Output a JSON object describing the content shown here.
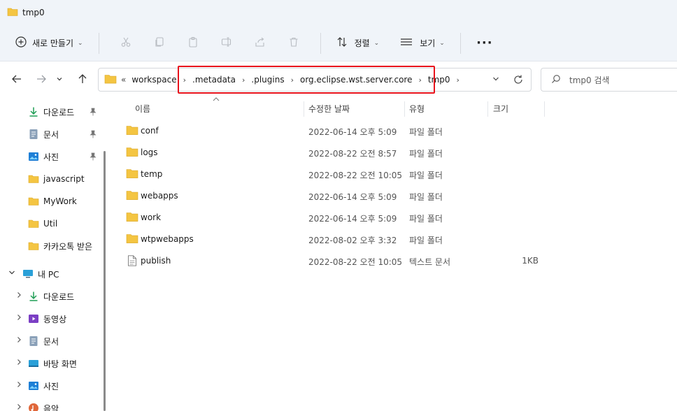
{
  "window": {
    "title": "tmp0"
  },
  "toolbar": {
    "new_label": "새로 만들기",
    "sort_label": "정렬",
    "view_label": "보기",
    "more_label": "···"
  },
  "address": {
    "overflow": "«",
    "crumbs": [
      "workspace",
      ".metadata",
      ".plugins",
      "org.eclipse.wst.server.core",
      "tmp0"
    ],
    "separator": "›"
  },
  "search": {
    "placeholder": "tmp0 검색"
  },
  "sidebar": {
    "quick": [
      {
        "label": "다운로드",
        "icon": "download-icon"
      },
      {
        "label": "문서",
        "icon": "document-icon"
      },
      {
        "label": "사진",
        "icon": "picture-icon"
      },
      {
        "label": "javascript",
        "icon": "folder-icon"
      },
      {
        "label": "MyWork",
        "icon": "folder-icon"
      },
      {
        "label": "Util",
        "icon": "folder-icon"
      },
      {
        "label": "카카오톡 받은",
        "icon": "folder-icon"
      }
    ],
    "pc": {
      "label": "내 PC",
      "icon": "pc-icon"
    },
    "pc_items": [
      {
        "label": "다운로드",
        "icon": "download-icon"
      },
      {
        "label": "동영상",
        "icon": "video-icon"
      },
      {
        "label": "문서",
        "icon": "document-icon"
      },
      {
        "label": "바탕 화면",
        "icon": "desktop-icon"
      },
      {
        "label": "사진",
        "icon": "picture-icon"
      },
      {
        "label": "음악",
        "icon": "music-icon"
      }
    ]
  },
  "columns": {
    "name": "이름",
    "date": "수정한 날짜",
    "type": "유형",
    "size": "크기"
  },
  "files": [
    {
      "name": "conf",
      "date": "2022-06-14 오후 5:09",
      "type": "파일 폴더",
      "size": "",
      "icon": "folder-icon"
    },
    {
      "name": "logs",
      "date": "2022-08-22 오전 8:57",
      "type": "파일 폴더",
      "size": "",
      "icon": "folder-icon"
    },
    {
      "name": "temp",
      "date": "2022-08-22 오전 10:05",
      "type": "파일 폴더",
      "size": "",
      "icon": "folder-icon"
    },
    {
      "name": "webapps",
      "date": "2022-06-14 오후 5:09",
      "type": "파일 폴더",
      "size": "",
      "icon": "folder-icon"
    },
    {
      "name": "work",
      "date": "2022-06-14 오후 5:09",
      "type": "파일 폴더",
      "size": "",
      "icon": "folder-icon"
    },
    {
      "name": "wtpwebapps",
      "date": "2022-08-02 오후 3:32",
      "type": "파일 폴더",
      "size": "",
      "icon": "folder-icon"
    },
    {
      "name": "publish",
      "date": "2022-08-22 오전 10:05",
      "type": "텍스트 문서",
      "size": "1KB",
      "icon": "text-file-icon"
    }
  ],
  "colors": {
    "folder": "#f4c542",
    "highlight": "#e8131c",
    "accent": "#0f6cbd",
    "chrome": "#f0f4f9"
  }
}
